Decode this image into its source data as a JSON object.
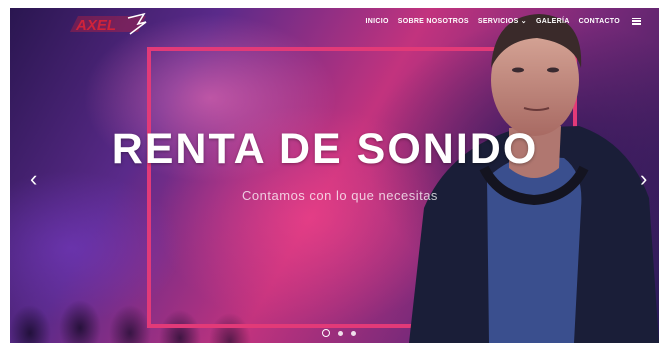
{
  "brand": {
    "logo_text": "AXEL"
  },
  "nav": {
    "items": [
      "INICIO",
      "SOBRE NOSOTROS",
      "SERVICIOS ⌄",
      "GALERÍA",
      "CONTACTO"
    ],
    "menu_icon": "hamburger-icon"
  },
  "hero": {
    "title": "RENTA DE SONIDO",
    "subtitle": "Contamos con lo que necesitas",
    "prev_icon": "‹",
    "next_icon": "›",
    "slides": 3,
    "active_slide": 1
  },
  "colors": {
    "accent_pink": "#e23a78",
    "logo_red": "#d0233a"
  }
}
